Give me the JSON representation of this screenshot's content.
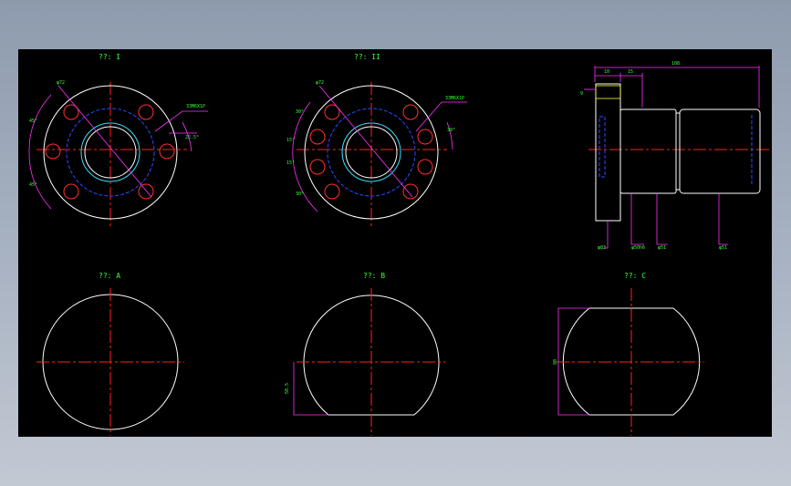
{
  "views": {
    "view_1": {
      "title": "??: I"
    },
    "view_2": {
      "title": "??: II"
    },
    "view_a": {
      "title": "??: A"
    },
    "view_b": {
      "title": "??: B"
    },
    "view_c": {
      "title": "??: C"
    }
  },
  "dimensions": {
    "v1_pcd": "φ72",
    "v1_thread": "33M6X1P",
    "v1_angle_1": "45°",
    "v1_angle_2": "45°",
    "v1_angle_3": "22.5°",
    "v2_pcd": "φ72",
    "v2_thread": "33M6X1P",
    "v2_angle_1": "30°",
    "v2_angle_2": "15°",
    "v2_angle_3": "15°",
    "v2_angle_4": "30°",
    "v2_angle_5": "30°",
    "side_total": "108",
    "side_flange": "10",
    "side_step": "15",
    "side_left": "9",
    "side_d1": "φ83",
    "side_d2": "φ50h6",
    "side_d3": "φ51",
    "side_d4": "φ51",
    "b_flat": "50.5",
    "c_width": "80"
  },
  "colors": {
    "background": "#000000",
    "outline": "#ffffff",
    "centerline": "#ff2020",
    "dimension_line": "#ff33ff",
    "dimension_text": "#39ff39",
    "hidden_line": "#2d4bff",
    "thread": "#33e0ff"
  }
}
